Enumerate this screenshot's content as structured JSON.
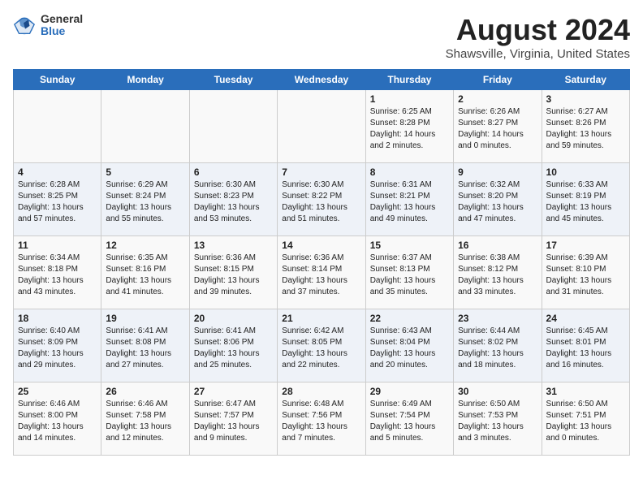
{
  "logo": {
    "general": "General",
    "blue": "Blue"
  },
  "title": "August 2024",
  "subtitle": "Shawsville, Virginia, United States",
  "headers": [
    "Sunday",
    "Monday",
    "Tuesday",
    "Wednesday",
    "Thursday",
    "Friday",
    "Saturday"
  ],
  "weeks": [
    [
      {
        "day": "",
        "info": ""
      },
      {
        "day": "",
        "info": ""
      },
      {
        "day": "",
        "info": ""
      },
      {
        "day": "",
        "info": ""
      },
      {
        "day": "1",
        "info": "Sunrise: 6:25 AM\nSunset: 8:28 PM\nDaylight: 14 hours\nand 2 minutes."
      },
      {
        "day": "2",
        "info": "Sunrise: 6:26 AM\nSunset: 8:27 PM\nDaylight: 14 hours\nand 0 minutes."
      },
      {
        "day": "3",
        "info": "Sunrise: 6:27 AM\nSunset: 8:26 PM\nDaylight: 13 hours\nand 59 minutes."
      }
    ],
    [
      {
        "day": "4",
        "info": "Sunrise: 6:28 AM\nSunset: 8:25 PM\nDaylight: 13 hours\nand 57 minutes."
      },
      {
        "day": "5",
        "info": "Sunrise: 6:29 AM\nSunset: 8:24 PM\nDaylight: 13 hours\nand 55 minutes."
      },
      {
        "day": "6",
        "info": "Sunrise: 6:30 AM\nSunset: 8:23 PM\nDaylight: 13 hours\nand 53 minutes."
      },
      {
        "day": "7",
        "info": "Sunrise: 6:30 AM\nSunset: 8:22 PM\nDaylight: 13 hours\nand 51 minutes."
      },
      {
        "day": "8",
        "info": "Sunrise: 6:31 AM\nSunset: 8:21 PM\nDaylight: 13 hours\nand 49 minutes."
      },
      {
        "day": "9",
        "info": "Sunrise: 6:32 AM\nSunset: 8:20 PM\nDaylight: 13 hours\nand 47 minutes."
      },
      {
        "day": "10",
        "info": "Sunrise: 6:33 AM\nSunset: 8:19 PM\nDaylight: 13 hours\nand 45 minutes."
      }
    ],
    [
      {
        "day": "11",
        "info": "Sunrise: 6:34 AM\nSunset: 8:18 PM\nDaylight: 13 hours\nand 43 minutes."
      },
      {
        "day": "12",
        "info": "Sunrise: 6:35 AM\nSunset: 8:16 PM\nDaylight: 13 hours\nand 41 minutes."
      },
      {
        "day": "13",
        "info": "Sunrise: 6:36 AM\nSunset: 8:15 PM\nDaylight: 13 hours\nand 39 minutes."
      },
      {
        "day": "14",
        "info": "Sunrise: 6:36 AM\nSunset: 8:14 PM\nDaylight: 13 hours\nand 37 minutes."
      },
      {
        "day": "15",
        "info": "Sunrise: 6:37 AM\nSunset: 8:13 PM\nDaylight: 13 hours\nand 35 minutes."
      },
      {
        "day": "16",
        "info": "Sunrise: 6:38 AM\nSunset: 8:12 PM\nDaylight: 13 hours\nand 33 minutes."
      },
      {
        "day": "17",
        "info": "Sunrise: 6:39 AM\nSunset: 8:10 PM\nDaylight: 13 hours\nand 31 minutes."
      }
    ],
    [
      {
        "day": "18",
        "info": "Sunrise: 6:40 AM\nSunset: 8:09 PM\nDaylight: 13 hours\nand 29 minutes."
      },
      {
        "day": "19",
        "info": "Sunrise: 6:41 AM\nSunset: 8:08 PM\nDaylight: 13 hours\nand 27 minutes."
      },
      {
        "day": "20",
        "info": "Sunrise: 6:41 AM\nSunset: 8:06 PM\nDaylight: 13 hours\nand 25 minutes."
      },
      {
        "day": "21",
        "info": "Sunrise: 6:42 AM\nSunset: 8:05 PM\nDaylight: 13 hours\nand 22 minutes."
      },
      {
        "day": "22",
        "info": "Sunrise: 6:43 AM\nSunset: 8:04 PM\nDaylight: 13 hours\nand 20 minutes."
      },
      {
        "day": "23",
        "info": "Sunrise: 6:44 AM\nSunset: 8:02 PM\nDaylight: 13 hours\nand 18 minutes."
      },
      {
        "day": "24",
        "info": "Sunrise: 6:45 AM\nSunset: 8:01 PM\nDaylight: 13 hours\nand 16 minutes."
      }
    ],
    [
      {
        "day": "25",
        "info": "Sunrise: 6:46 AM\nSunset: 8:00 PM\nDaylight: 13 hours\nand 14 minutes."
      },
      {
        "day": "26",
        "info": "Sunrise: 6:46 AM\nSunset: 7:58 PM\nDaylight: 13 hours\nand 12 minutes."
      },
      {
        "day": "27",
        "info": "Sunrise: 6:47 AM\nSunset: 7:57 PM\nDaylight: 13 hours\nand 9 minutes."
      },
      {
        "day": "28",
        "info": "Sunrise: 6:48 AM\nSunset: 7:56 PM\nDaylight: 13 hours\nand 7 minutes."
      },
      {
        "day": "29",
        "info": "Sunrise: 6:49 AM\nSunset: 7:54 PM\nDaylight: 13 hours\nand 5 minutes."
      },
      {
        "day": "30",
        "info": "Sunrise: 6:50 AM\nSunset: 7:53 PM\nDaylight: 13 hours\nand 3 minutes."
      },
      {
        "day": "31",
        "info": "Sunrise: 6:50 AM\nSunset: 7:51 PM\nDaylight: 13 hours\nand 0 minutes."
      }
    ]
  ]
}
